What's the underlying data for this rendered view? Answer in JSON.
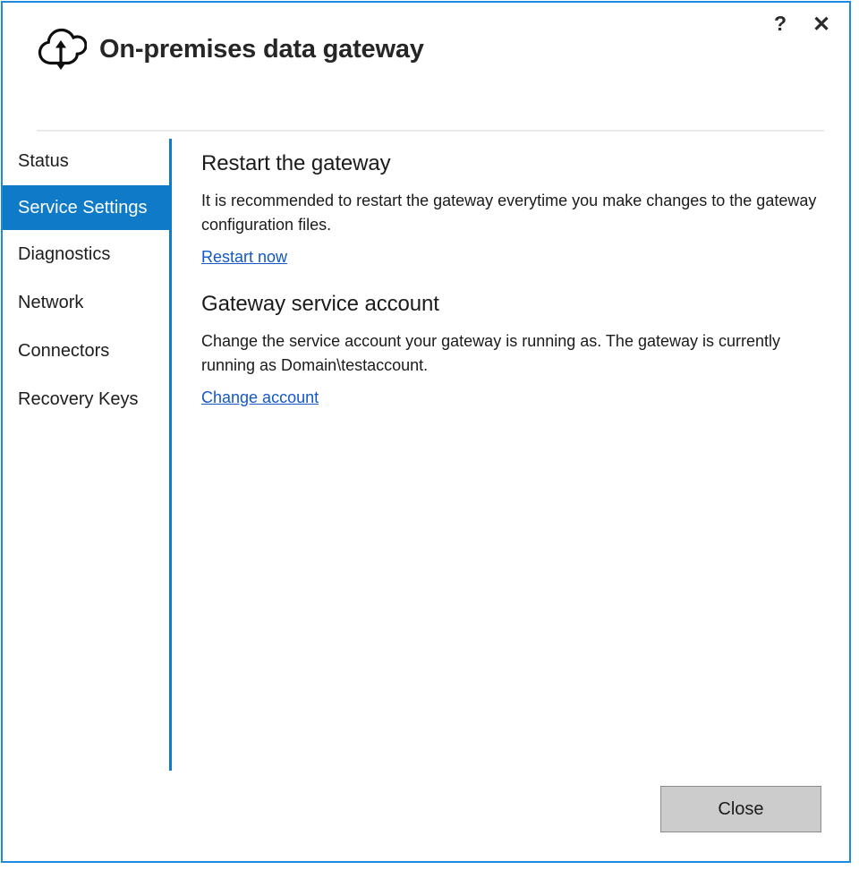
{
  "window": {
    "title": "On-premises data gateway",
    "app_icon": "cloud-sync-icon",
    "border_color": "#1b8ae0"
  },
  "caption": {
    "help_label": "?",
    "help_icon": "help-question-icon",
    "close_label": "✕",
    "close_icon": "close-x-icon"
  },
  "sidebar": {
    "selected_index": 1,
    "accent_color": "#0e7ac8",
    "items": [
      {
        "label": "Status"
      },
      {
        "label": "Service Settings"
      },
      {
        "label": "Diagnostics"
      },
      {
        "label": "Network"
      },
      {
        "label": "Connectors"
      },
      {
        "label": "Recovery Keys"
      }
    ]
  },
  "content": {
    "sections": [
      {
        "heading": "Restart the gateway",
        "body": "It is recommended to restart the gateway everytime you make changes to the gateway configuration files.",
        "link": "Restart now"
      },
      {
        "heading": "Gateway service account",
        "body": "Change the service account your gateway is running as. The gateway is currently running as Domain\\testaccount.",
        "link": "Change account"
      }
    ],
    "link_color": "#1357c8"
  },
  "footer": {
    "close_button_label": "Close"
  }
}
